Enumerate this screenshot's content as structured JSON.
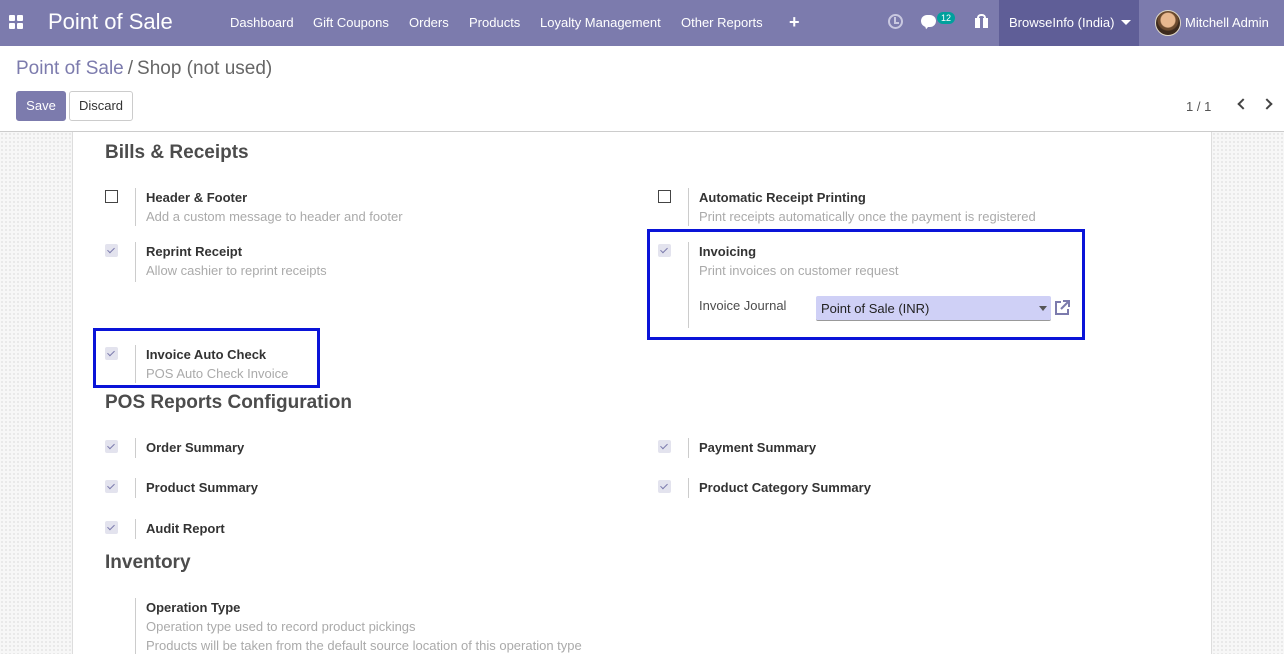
{
  "navbar": {
    "brand": "Point of Sale",
    "menu": [
      "Dashboard",
      "Gift Coupons",
      "Orders",
      "Products",
      "Loyalty Management",
      "Other Reports"
    ],
    "add_icon": "plus-icon",
    "messages_badge": "12",
    "company": "BrowseInfo (India)",
    "user": "Mitchell Admin",
    "color": "#7c7bad"
  },
  "breadcrumb": {
    "parent": "Point of Sale",
    "separator": "/",
    "current": "Shop (not used)"
  },
  "buttons": {
    "save": "Save",
    "discard": "Discard"
  },
  "pager": {
    "value": "1 / 1"
  },
  "bills": {
    "title": "Bills & Receipts",
    "header_footer": {
      "title": "Header & Footer",
      "desc": "Add a custom message to header and footer",
      "checked": false
    },
    "auto_print": {
      "title": "Automatic Receipt Printing",
      "desc": "Print receipts automatically once the payment is registered",
      "checked": false
    },
    "reprint": {
      "title": "Reprint Receipt",
      "desc": "Allow cashier to reprint receipts",
      "checked": true
    },
    "invoicing": {
      "title": "Invoicing",
      "desc": "Print invoices on customer request",
      "checked": true,
      "journal_label": "Invoice Journal",
      "journal_value": "Point of Sale (INR)"
    },
    "auto_check": {
      "title": "Invoice Auto Check",
      "desc": "POS Auto Check Invoice",
      "checked": true
    }
  },
  "reports": {
    "title": "POS Reports Configuration",
    "order_summary": "Order Summary",
    "payment_summary": "Payment Summary",
    "product_summary": "Product Summary",
    "category_summary": "Product Category Summary",
    "audit_report": "Audit Report"
  },
  "inventory": {
    "title": "Inventory",
    "operation_type": {
      "title": "Operation Type",
      "desc1": "Operation type used to record product pickings",
      "desc2": "Products will be taken from the default source location of this operation type"
    }
  },
  "highlight_color": "#0a14d8"
}
